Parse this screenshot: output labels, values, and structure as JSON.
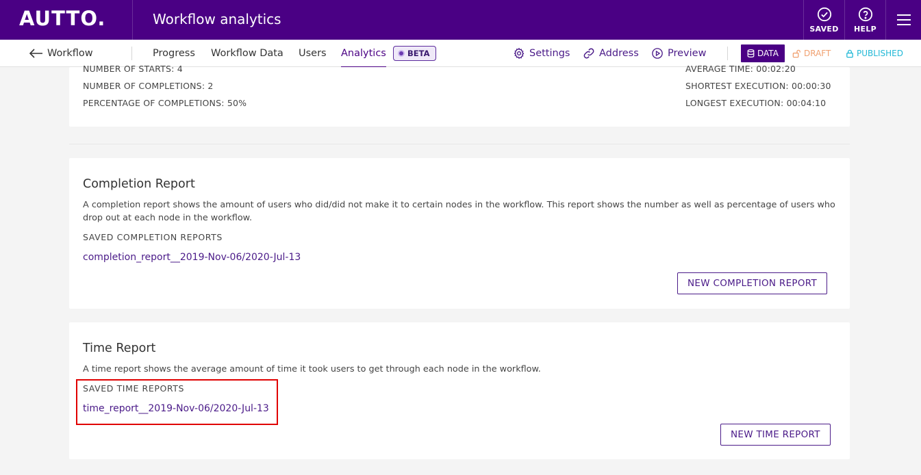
{
  "topbar": {
    "logo": "AUTTO.",
    "title": "Workflow analytics",
    "saved_label": "SAVED",
    "help_label": "HELP",
    "menu_icon": "hamburger-menu-icon",
    "colors": {
      "brand": "#4a0084"
    }
  },
  "subnav": {
    "back_label": "Workflow",
    "tabs": [
      {
        "label": "Progress"
      },
      {
        "label": "Workflow Data"
      },
      {
        "label": "Users"
      },
      {
        "label": "Analytics",
        "active": true
      }
    ],
    "beta_label": "BETA",
    "settings_label": "Settings",
    "address_label": "Address",
    "preview_label": "Preview",
    "status": {
      "data_label": "DATA",
      "draft_label": "DRAFT",
      "published_label": "PUBLISHED",
      "colors": {
        "data": "#4a0084",
        "draft": "#f0a070",
        "published": "#21b8d6"
      }
    }
  },
  "stats": {
    "starts": "NUMBER OF STARTS: 4",
    "completions": "NUMBER OF COMPLETIONS: 2",
    "percentage": "PERCENTAGE OF COMPLETIONS: 50%",
    "average_time": "AVERAGE TIME: 00:02:20",
    "shortest": "SHORTEST EXECUTION: 00:00:30",
    "longest": "LONGEST EXECUTION: 00:04:10"
  },
  "completion_report": {
    "title": "Completion Report",
    "description": "A completion report shows the amount of users who did/did not make it to certain nodes in the workflow. This report shows the number as well as percentage of users who drop out at each node in the workflow.",
    "saved_label": "SAVED COMPLETION REPORTS",
    "reports": [
      "completion_report__2019-Nov-06/2020-Jul-13"
    ],
    "new_button": "NEW COMPLETION REPORT"
  },
  "time_report": {
    "title": "Time Report",
    "description": "A time report shows the average amount of time it took users to get through each node in the workflow.",
    "saved_label": "SAVED TIME REPORTS",
    "reports": [
      "time_report__2019-Nov-06/2020-Jul-13"
    ],
    "new_button": "NEW TIME REPORT"
  }
}
